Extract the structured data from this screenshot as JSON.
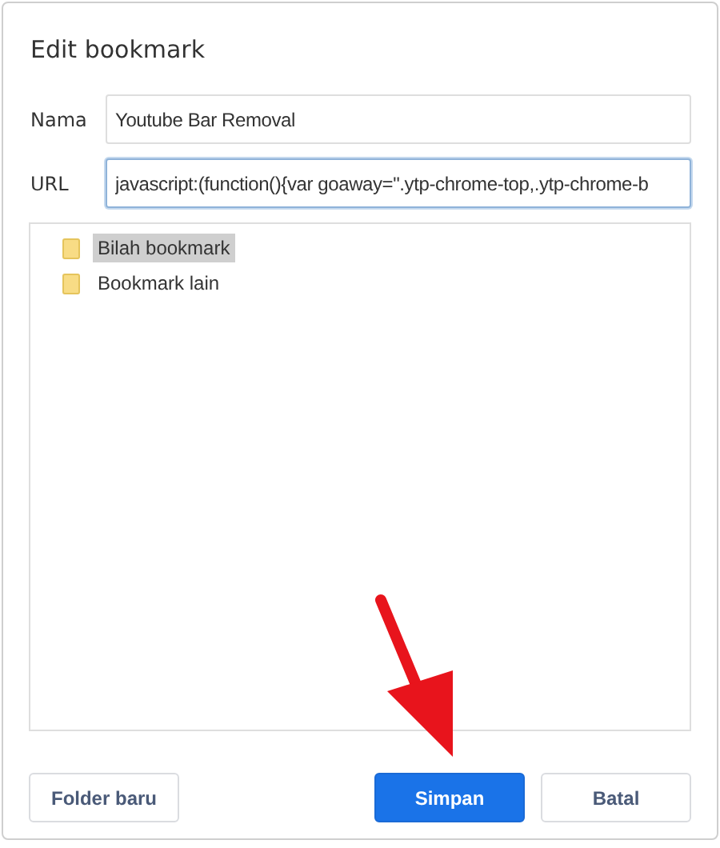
{
  "dialog": {
    "title": "Edit bookmark"
  },
  "fields": [
    {
      "label": "Nama",
      "value": "Youtube Bar Removal",
      "focused": false
    },
    {
      "label": "URL",
      "value": "javascript:(function(){var goaway=\".ytp-chrome-top,.ytp-chrome-b",
      "focused": true
    }
  ],
  "folders": [
    {
      "label": "Bilah bookmark",
      "selected": true
    },
    {
      "label": "Bookmark lain",
      "selected": false
    }
  ],
  "buttons": [
    {
      "label": "Folder baru",
      "kind": "secondary"
    },
    {
      "label": "Simpan",
      "kind": "primary"
    },
    {
      "label": "Batal",
      "kind": "secondary"
    }
  ]
}
